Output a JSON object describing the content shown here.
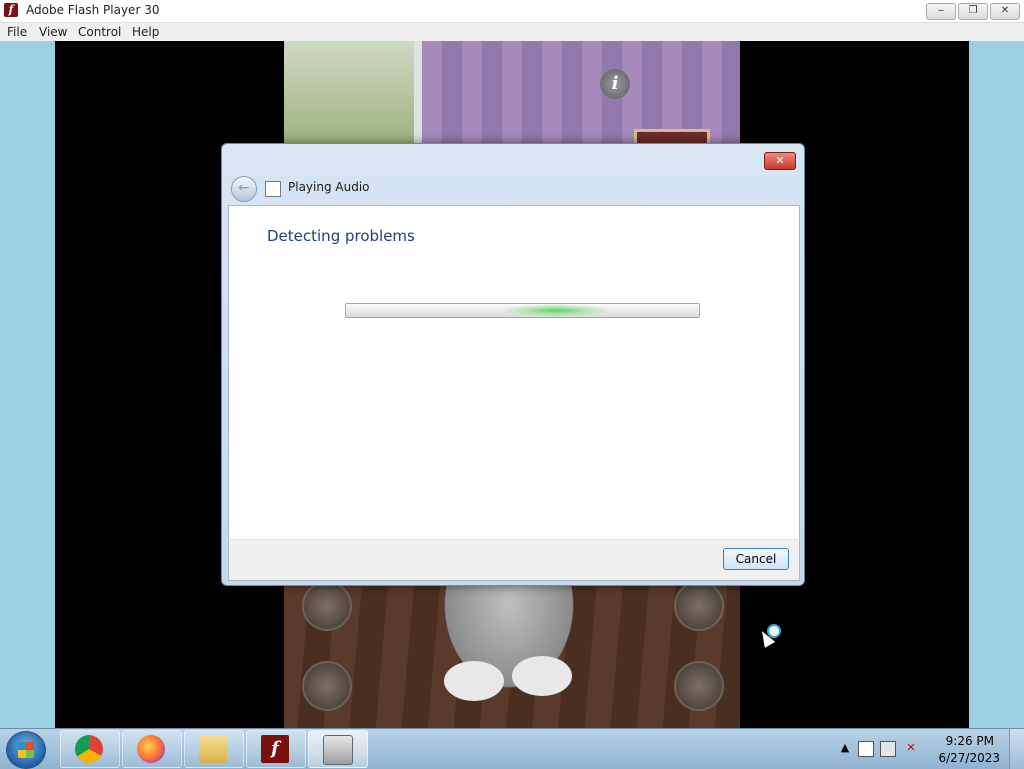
{
  "window": {
    "title": "Adobe Flash Player 30",
    "icon": "flash-icon",
    "controls": {
      "minimize": "‒",
      "maximize": "❐",
      "close": "✕"
    }
  },
  "menu": [
    "File",
    "View",
    "Control",
    "Help"
  ],
  "game": {
    "info_glyph": "i"
  },
  "dialog": {
    "title": "Playing Audio",
    "heading": "Detecting problems",
    "progress": "indeterminate",
    "cancel_label": "Cancel",
    "close_glyph": "✕",
    "back_glyph": "←"
  },
  "taskbar": {
    "pinned": [
      "chrome-icon",
      "firefox-icon",
      "file-explorer-icon",
      "flash-player-icon",
      "troubleshooter-icon"
    ],
    "clock_time": "9:26 PM",
    "clock_date": "6/27/2023",
    "tray_arrow": "▲"
  }
}
